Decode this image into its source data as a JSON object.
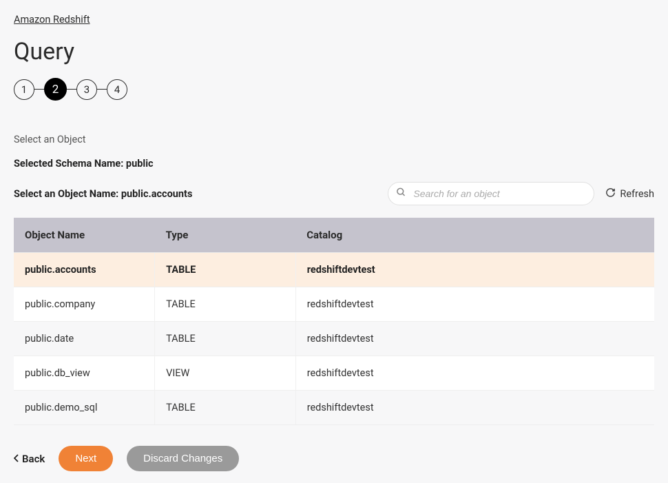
{
  "breadcrumb": "Amazon Redshift",
  "page_title": "Query",
  "stepper": {
    "steps": [
      "1",
      "2",
      "3",
      "4"
    ],
    "active_index": 1
  },
  "section_label": "Select an Object",
  "schema_label_prefix": "Selected Schema Name: ",
  "schema_name": "public",
  "object_label_prefix": "Select an Object Name: ",
  "selected_object": "public.accounts",
  "search": {
    "placeholder": "Search for an object"
  },
  "refresh_label": "Refresh",
  "table": {
    "headers": {
      "name": "Object Name",
      "type": "Type",
      "catalog": "Catalog"
    },
    "rows": [
      {
        "name": "public.accounts",
        "type": "TABLE",
        "catalog": "redshiftdevtest",
        "selected": true
      },
      {
        "name": "public.company",
        "type": "TABLE",
        "catalog": "redshiftdevtest",
        "selected": false
      },
      {
        "name": "public.date",
        "type": "TABLE",
        "catalog": "redshiftdevtest",
        "selected": false
      },
      {
        "name": "public.db_view",
        "type": "VIEW",
        "catalog": "redshiftdevtest",
        "selected": false
      },
      {
        "name": "public.demo_sql",
        "type": "TABLE",
        "catalog": "redshiftdevtest",
        "selected": false
      }
    ]
  },
  "actions": {
    "back": "Back",
    "next": "Next",
    "discard": "Discard Changes"
  }
}
